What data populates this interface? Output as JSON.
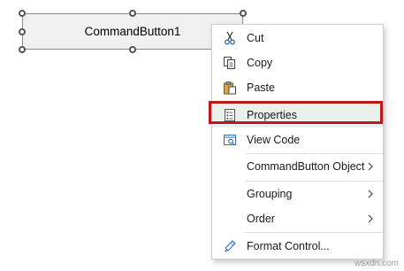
{
  "button": {
    "label": "CommandButton1"
  },
  "menu": {
    "items": [
      {
        "label": "Cut",
        "icon": "scissors-icon",
        "has_submenu": false
      },
      {
        "label": "Copy",
        "icon": "copy-icon",
        "has_submenu": false
      },
      {
        "label": "Paste",
        "icon": "paste-icon",
        "has_submenu": false
      },
      {
        "label": "Properties",
        "icon": "properties-icon",
        "has_submenu": false,
        "highlighted": true
      },
      {
        "label": "View Code",
        "icon": "view-code-icon",
        "has_submenu": false
      },
      {
        "label": "CommandButton Object",
        "icon": "",
        "has_submenu": true
      },
      {
        "label": "Grouping",
        "icon": "",
        "has_submenu": true
      },
      {
        "label": "Order",
        "icon": "",
        "has_submenu": true
      },
      {
        "label": "Format Control...",
        "icon": "format-control-icon",
        "has_submenu": false
      }
    ]
  },
  "colors": {
    "highlight_border": "#c0161c",
    "highlight_fill": "#e9f1ea"
  },
  "watermark": "wsxdn.com"
}
